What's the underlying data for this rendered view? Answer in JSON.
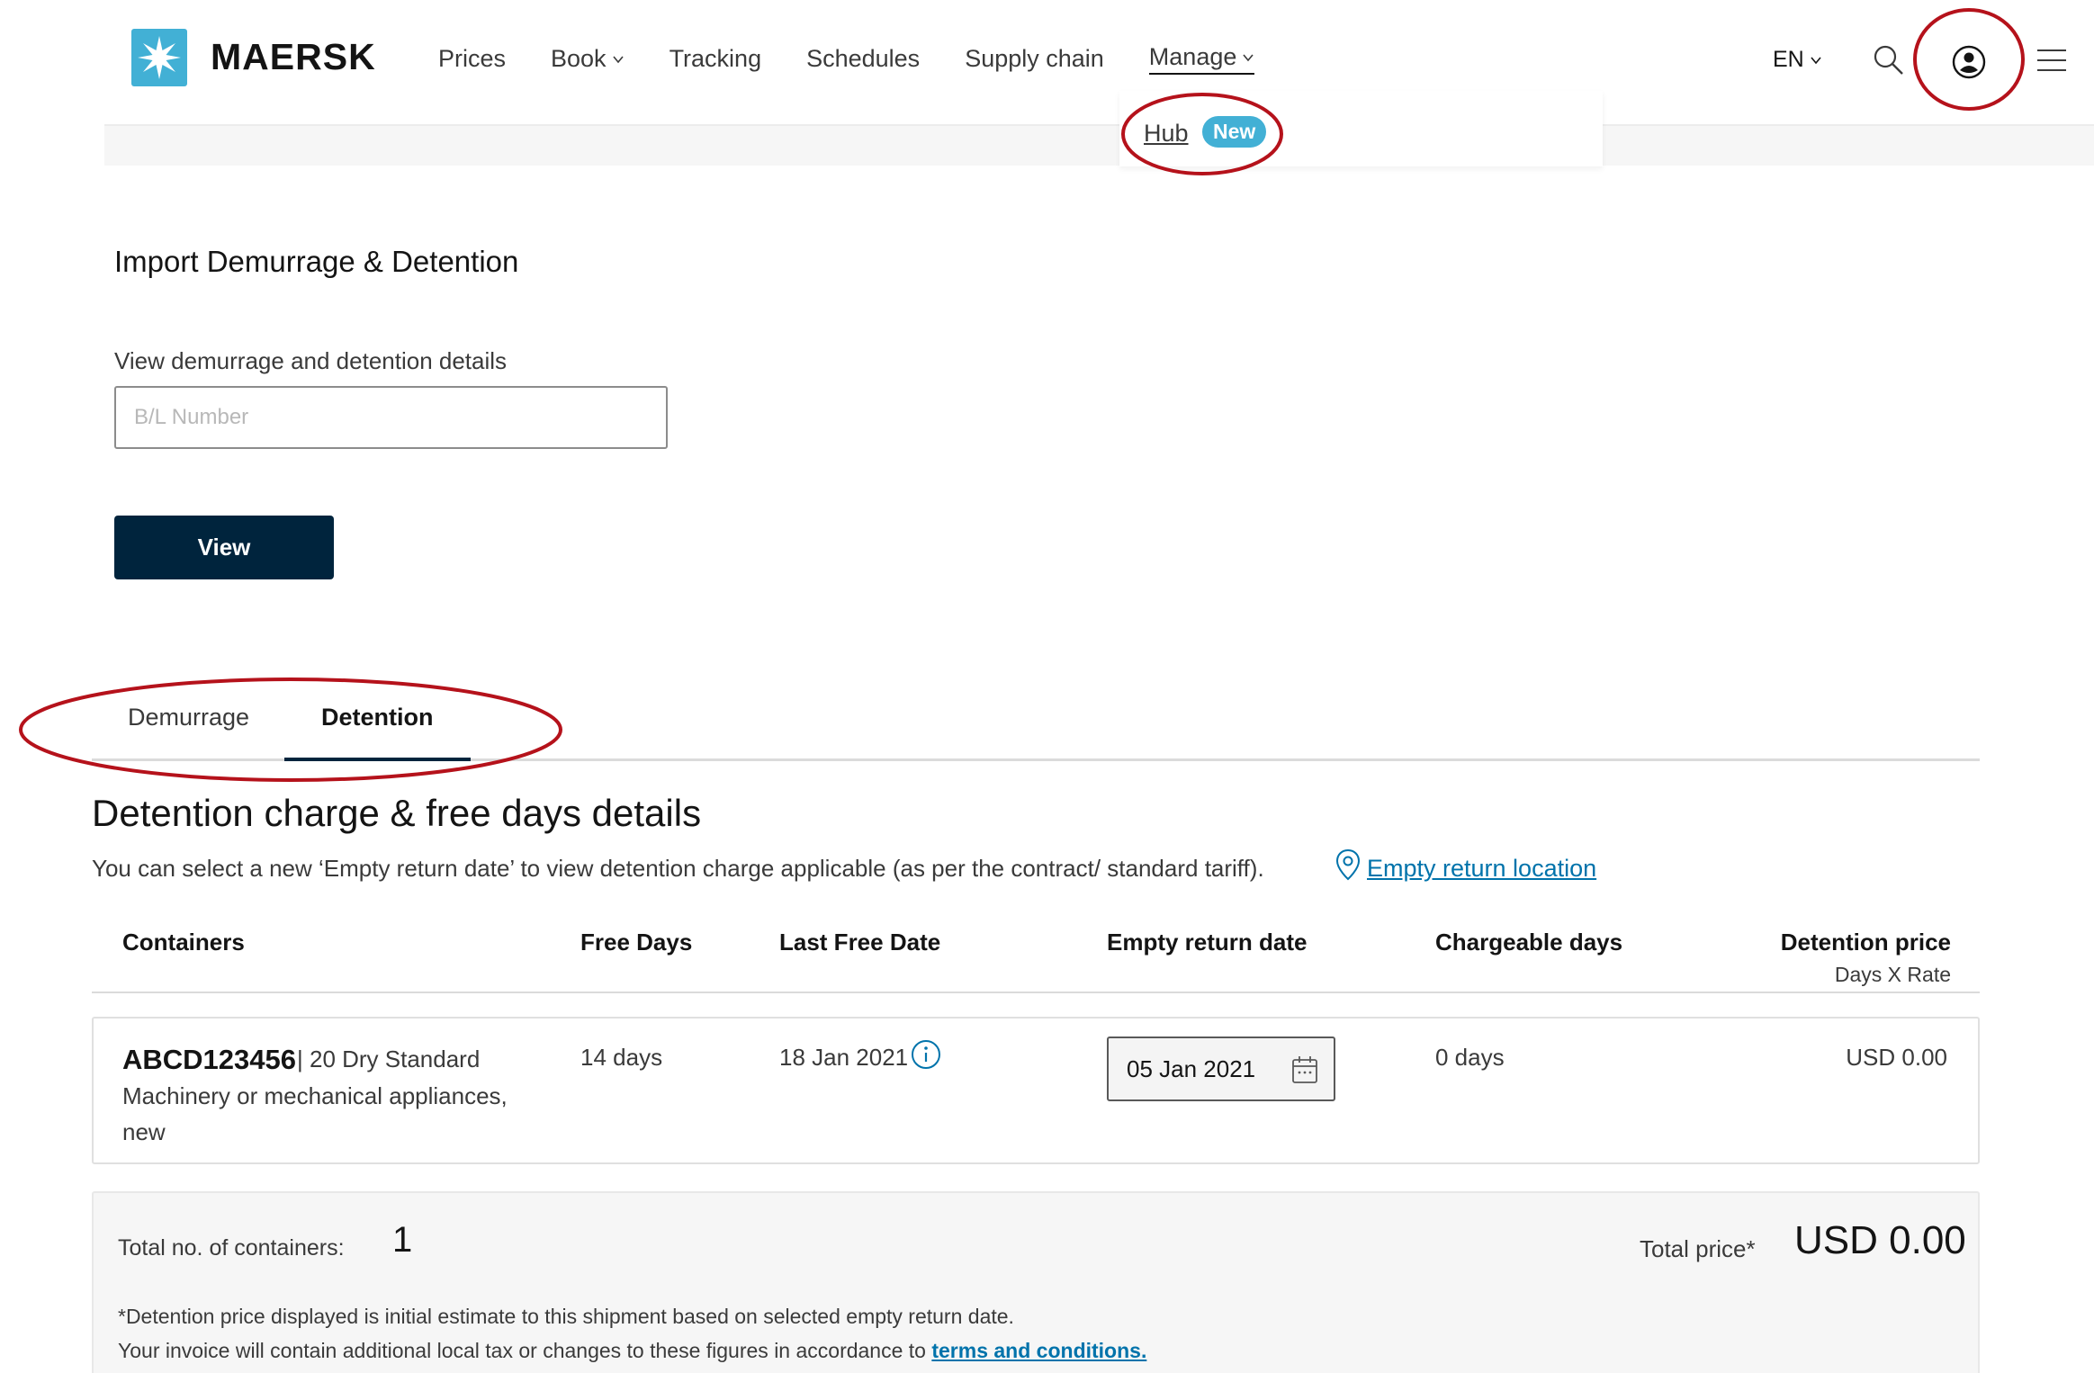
{
  "header": {
    "brand": "MAERSK",
    "nav": [
      {
        "label": "Prices",
        "has_dropdown": false
      },
      {
        "label": "Book",
        "has_dropdown": true
      },
      {
        "label": "Tracking",
        "has_dropdown": false
      },
      {
        "label": "Schedules",
        "has_dropdown": false
      },
      {
        "label": "Supply chain",
        "has_dropdown": false
      },
      {
        "label": "Manage",
        "has_dropdown": true
      }
    ],
    "language": "EN"
  },
  "manage_dropdown": {
    "hub_label": "Hub",
    "new_badge": "New"
  },
  "import": {
    "title": "Import Demurrage & Detention",
    "field_label": "View demurrage and detention details",
    "placeholder": "B/L Number",
    "value": "",
    "button": "View"
  },
  "tabs": [
    {
      "label": "Demurrage",
      "active": false
    },
    {
      "label": "Detention",
      "active": true
    }
  ],
  "detention": {
    "title": "Detention charge & free days details",
    "description": "You can select a new ‘Empty return date’ to view detention charge applicable (as per the contract/ standard tariff).",
    "empty_return_link": "Empty return location",
    "columns": {
      "containers": "Containers",
      "free_days": "Free Days",
      "last_free_date": "Last Free Date",
      "empty_return_date": "Empty return date",
      "chargeable_days": "Chargeable days",
      "detention_price": "Detention price",
      "detention_price_sub": "Days X Rate"
    },
    "rows": [
      {
        "container_id": "ABCD123456",
        "container_type": "| 20 Dry Standard",
        "commodity": "Machinery or mechanical appliances, new",
        "free_days": "14 days",
        "last_free_date": "18 Jan 2021",
        "empty_return_date": "05 Jan 2021",
        "chargeable_days": "0 days",
        "detention_price": "USD 0.00"
      }
    ],
    "totals": {
      "containers_label": "Total no. of containers:",
      "containers_count": "1",
      "price_label": "Total price*",
      "price": "USD 0.00",
      "footnote_1": "*Detention price displayed is initial estimate to this shipment based on selected empty return date.",
      "footnote_2_prefix": "Your invoice will contain additional local tax or changes to these figures in accordance to",
      "terms_link": "terms and conditions."
    }
  },
  "colors": {
    "brand_blue": "#42b0d5",
    "navy": "#00243d",
    "link": "#0073ab",
    "annotation_red": "#b5121b"
  }
}
